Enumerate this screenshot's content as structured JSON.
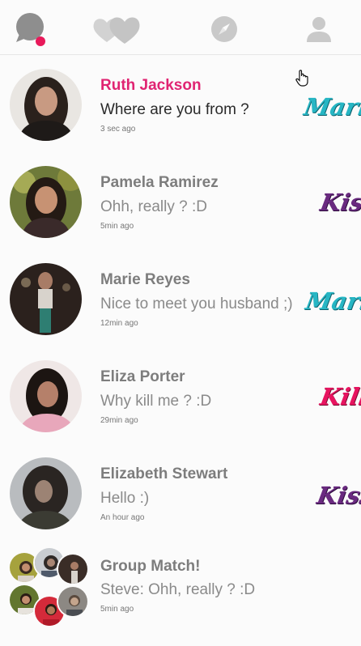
{
  "nav": {
    "tabs": [
      {
        "icon": "chat-bubble-icon",
        "active": true,
        "badge_color": "#e8195a"
      },
      {
        "icon": "hearts-icon",
        "active": false
      },
      {
        "icon": "compass-icon",
        "active": false
      },
      {
        "icon": "person-icon",
        "active": false
      }
    ]
  },
  "colors": {
    "accent": "#e02472",
    "marry": "#27b6c4",
    "kiss": "#6a2a80",
    "kill": "#e81460",
    "icon_gray": "#c9c9c9",
    "chat_icon": "#8e8e8e"
  },
  "conversations": [
    {
      "name": "Ruth Jackson",
      "message": "Where are you from ?",
      "time": "3 sec ago",
      "tag": "Marry",
      "active": true
    },
    {
      "name": "Pamela Ramirez",
      "message": "Ohh, really ? :D",
      "time": "5min ago",
      "tag": "Kiss",
      "active": false
    },
    {
      "name": "Marie Reyes",
      "message": "Nice to meet you husband ;)",
      "time": "12min ago",
      "tag": "Marry",
      "active": false
    },
    {
      "name": "Eliza Porter",
      "message": "Why kill me ? :D",
      "time": "29min ago",
      "tag": "Kill",
      "active": false
    },
    {
      "name": "Elizabeth Stewart",
      "message": "Hello :)",
      "time": "An hour ago",
      "tag": "Kiss",
      "active": false
    },
    {
      "name": "Group Match!",
      "message": "Steve: Ohh, really ? :D",
      "time": "5min ago",
      "tag": "",
      "active": false
    }
  ]
}
